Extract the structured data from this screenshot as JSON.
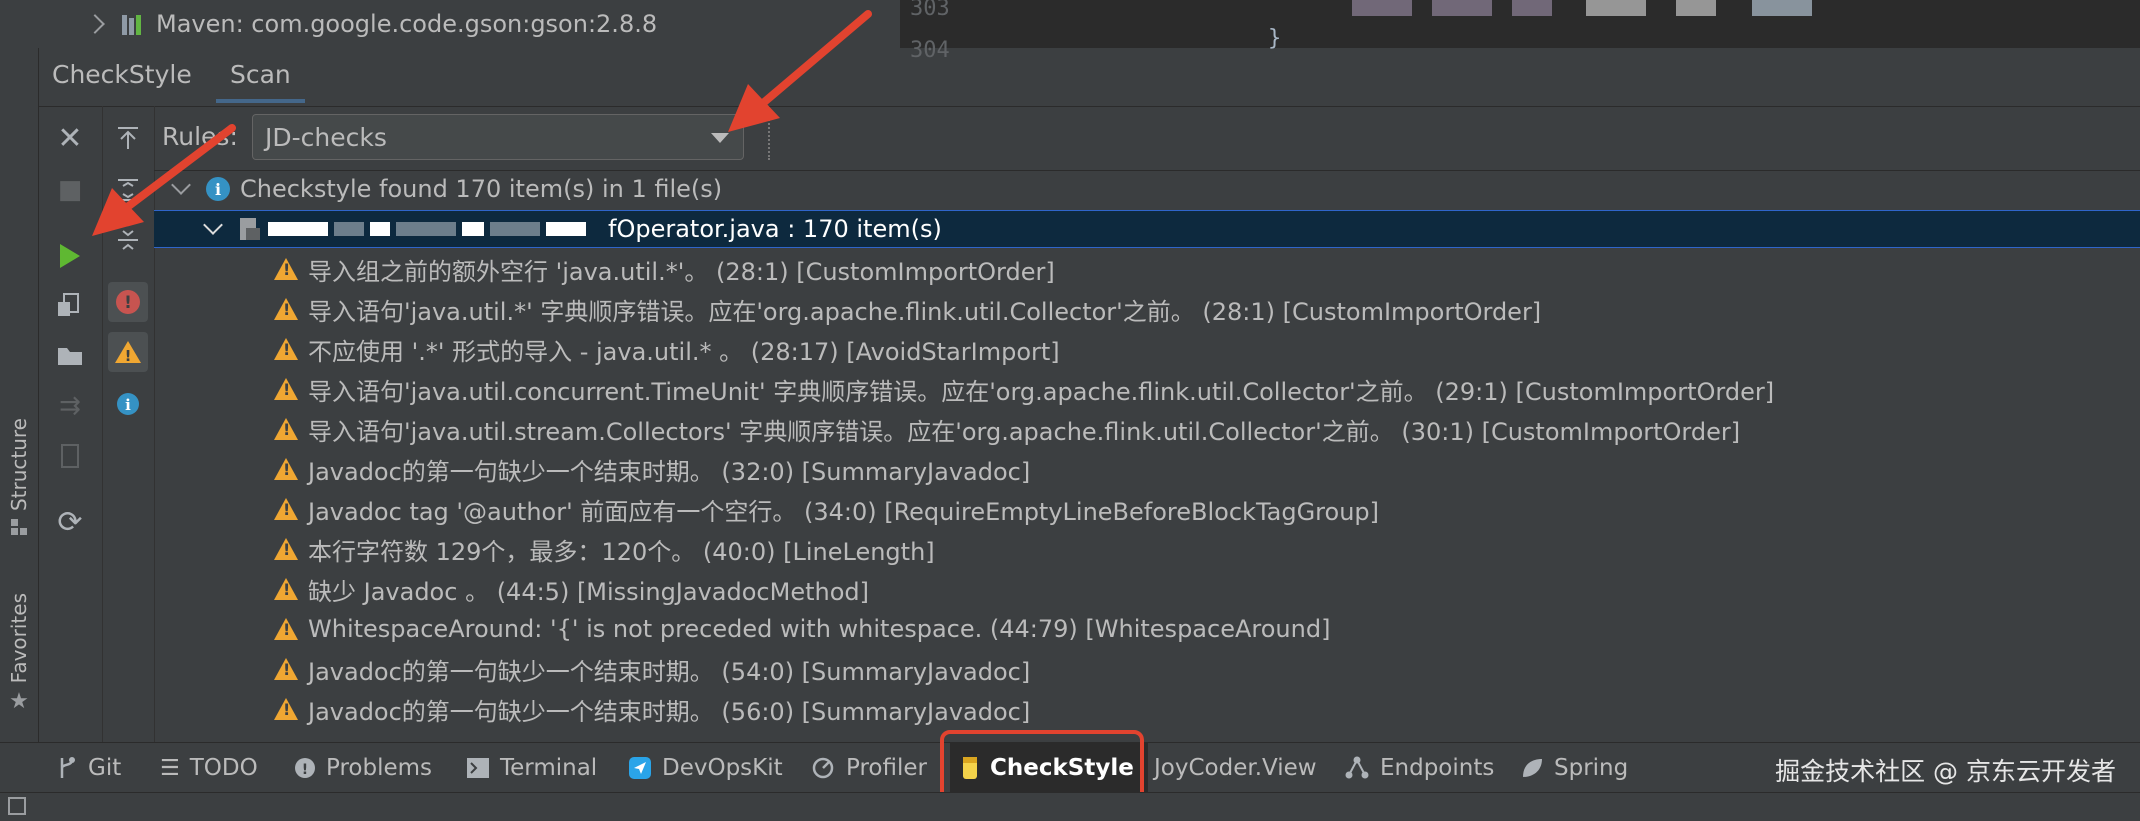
{
  "top": {
    "tree_item": "Maven: com.google.code.gson:gson:2.8.8",
    "editor_line_a": "303",
    "editor_line_b": "304",
    "editor_brace": "}"
  },
  "left_strip": {
    "structure": "Structure",
    "favorites": "Favorites"
  },
  "tabs": [
    {
      "label": "CheckStyle"
    },
    {
      "label": "Scan"
    }
  ],
  "rules": {
    "label": "Rules:",
    "selected": "JD-checks"
  },
  "tree": {
    "summary": "Checkstyle found 170 item(s) in 1 file(s)",
    "file": "fOperator.java : 170 item(s)",
    "items": [
      "导入组之前的额外空行 'java.util.*'。 (28:1) [CustomImportOrder]",
      "导入语句'java.util.*' 字典顺序错误。应在'org.apache.flink.util.Collector'之前。 (28:1) [CustomImportOrder]",
      "不应使用 '.*' 形式的导入 - java.util.* 。 (28:17) [AvoidStarImport]",
      "导入语句'java.util.concurrent.TimeUnit' 字典顺序错误。应在'org.apache.flink.util.Collector'之前。 (29:1) [CustomImportOrder]",
      "导入语句'java.util.stream.Collectors' 字典顺序错误。应在'org.apache.flink.util.Collector'之前。 (30:1) [CustomImportOrder]",
      "Javadoc的第一句缺少一个结束时期。 (32:0) [SummaryJavadoc]",
      "Javadoc tag '@author' 前面应有一个空行。 (34:0) [RequireEmptyLineBeforeBlockTagGroup]",
      "本行字符数 129个，最多：120个。 (40:0) [LineLength]",
      "缺少 Javadoc 。 (44:5) [MissingJavadocMethod]",
      "WhitespaceAround: '{' is not preceded with whitespace. (44:79) [WhitespaceAround]",
      "Javadoc的第一句缺少一个结束时期。 (54:0) [SummaryJavadoc]",
      "Javadoc的第一句缺少一个结束时期。 (56:0) [SummaryJavadoc]"
    ]
  },
  "bottom_tabs": [
    {
      "label": "Git",
      "icon": "git-branch-icon"
    },
    {
      "label": "TODO",
      "icon": "list-icon"
    },
    {
      "label": "Problems",
      "icon": "problems-icon"
    },
    {
      "label": "Terminal",
      "icon": "terminal-icon"
    },
    {
      "label": "DevOpsKit",
      "icon": "devops-icon"
    },
    {
      "label": "Profiler",
      "icon": "profiler-icon"
    },
    {
      "label": "CheckStyle",
      "icon": "checkstyle-icon"
    },
    {
      "label": "JoyCoder.View",
      "icon": ""
    },
    {
      "label": "Endpoints",
      "icon": "endpoints-icon"
    },
    {
      "label": "Spring",
      "icon": "spring-icon"
    }
  ],
  "watermark": "掘金技术社区 @ 京东云开发者",
  "colors": {
    "warning": "#f0a732",
    "info": "#3592c4",
    "selection": "#0d293e",
    "annotation": "#e2432f"
  }
}
